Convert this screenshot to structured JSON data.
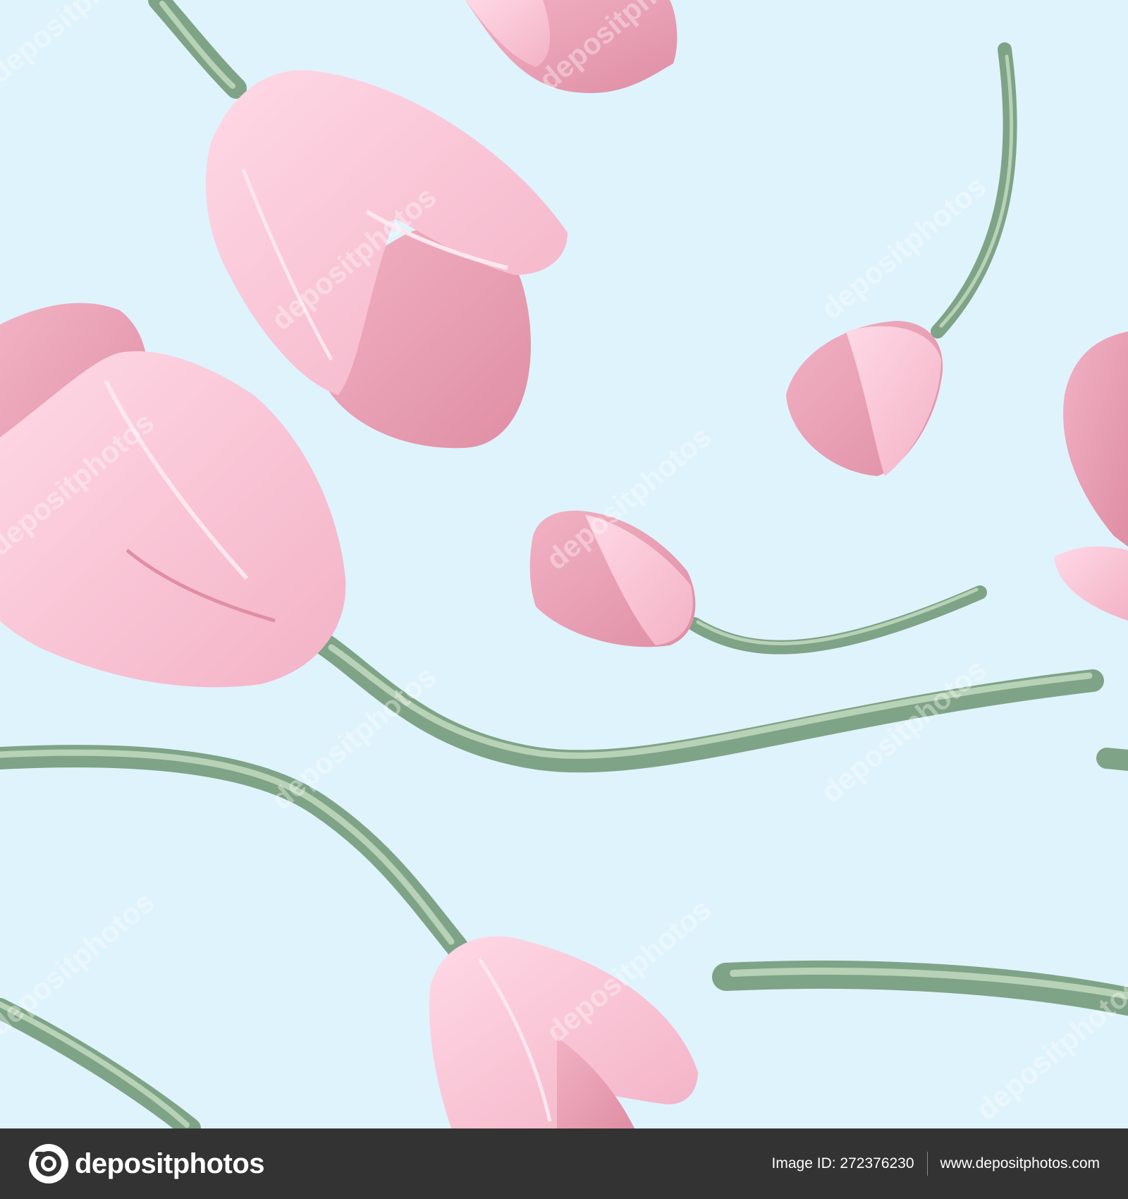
{
  "image": {
    "background_color": "#dff3fc",
    "subject": "Seamless pattern of pink tulips with green stems on a light blue background",
    "flower_colors": [
      "#f8c8d8",
      "#e89aae",
      "#f4b6c8"
    ],
    "stem_colors": [
      "#7fa386",
      "#b7d2b6"
    ]
  },
  "watermark": {
    "text": "depositphotos"
  },
  "footer": {
    "logo_text": "depositphotos",
    "image_id_label": "Image ID:",
    "image_id": "272376230",
    "site_url": "www.depositphotos.com",
    "background_color": "#333333"
  }
}
